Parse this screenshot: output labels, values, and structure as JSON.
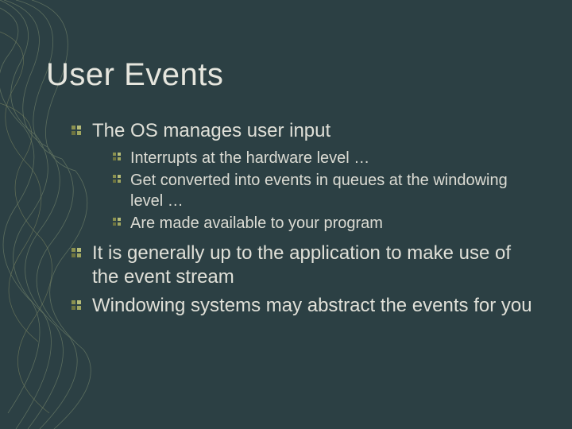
{
  "title": "User Events",
  "bullets": [
    {
      "text": "The OS manages user input",
      "sub": [
        "Interrupts at the hardware level …",
        "Get converted into events in queues at the windowing level …",
        "Are made available to your program"
      ]
    },
    {
      "text": "It is generally up to the application to make use of the event stream",
      "sub": []
    },
    {
      "text": "Windowing systems may abstract the events for you",
      "sub": []
    }
  ]
}
